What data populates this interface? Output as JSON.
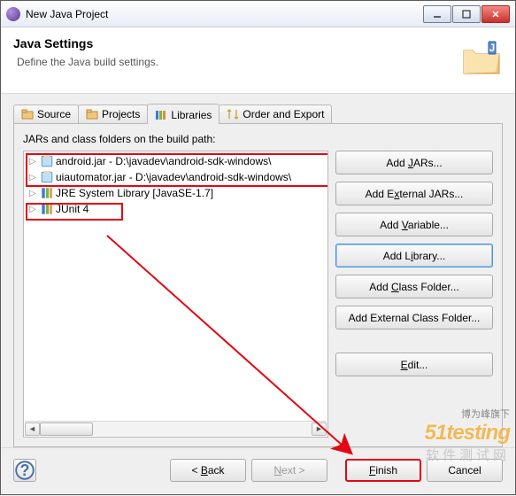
{
  "titlebar": {
    "title": "New Java Project"
  },
  "banner": {
    "heading": "Java Settings",
    "sub": "Define the Java build settings."
  },
  "tabs": {
    "source": "Source",
    "projects": "Projects",
    "libraries": "Libraries",
    "order": "Order and Export"
  },
  "panel": {
    "label": "JARs and class folders on the build path:",
    "tree": [
      {
        "label": "android.jar - D:\\javadev\\android-sdk-windows\\"
      },
      {
        "label": "uiautomator.jar - D:\\javadev\\android-sdk-windows\\"
      },
      {
        "label": "JRE System Library [JavaSE-1.7]"
      },
      {
        "label": "JUnit 4"
      }
    ]
  },
  "buttons": {
    "add_jars": "Add JARs...",
    "add_ext_jars": "Add External JARs...",
    "add_variable": "Add Variable...",
    "add_library": "Add Library...",
    "add_class_folder": "Add Class Folder...",
    "add_ext_class_folder": "Add External Class Folder...",
    "edit": "Edit...",
    "help": "?",
    "back": "< Back",
    "next": "Next >",
    "finish": "Finish",
    "cancel": "Cancel"
  },
  "watermark": {
    "line1": "博为峰旗下",
    "line2": "51testing",
    "line3": "软件测试网"
  }
}
